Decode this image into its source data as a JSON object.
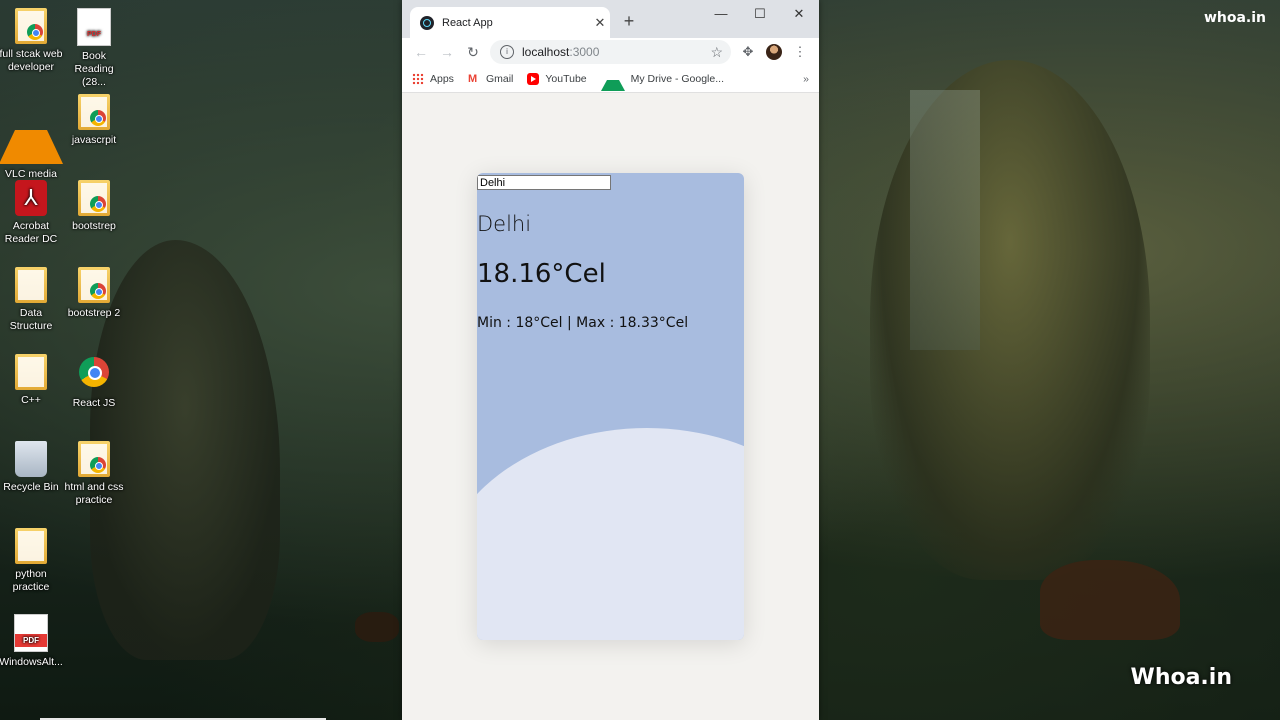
{
  "desktop": {
    "icons": [
      {
        "label": "full stcak web developer",
        "icon": "folder-chrome-icon"
      },
      {
        "label": "Book Reading (28...",
        "icon": "pdf-icon"
      },
      {
        "label": "VLC media player",
        "icon": "vlc-icon"
      },
      {
        "label": "javascrpit",
        "icon": "folder-chrome-icon"
      },
      {
        "label": "Acrobat Reader DC",
        "icon": "acrobat-icon"
      },
      {
        "label": "bootstrep",
        "icon": "folder-chrome-icon"
      },
      {
        "label": "Data Structure",
        "icon": "folder-icon"
      },
      {
        "label": "bootstrep 2",
        "icon": "folder-chrome-icon"
      },
      {
        "label": "C++",
        "icon": "folder-icon"
      },
      {
        "label": "React JS",
        "icon": "chrome-icon"
      },
      {
        "label": "Recycle Bin",
        "icon": "recycle-bin-icon"
      },
      {
        "label": "html and css practice",
        "icon": "folder-chrome-icon"
      },
      {
        "label": "python practice",
        "icon": "folder-icon"
      },
      {
        "label": "WindowsAlt...",
        "icon": "pdf-icon"
      }
    ],
    "watermark_top": "whoa.in",
    "watermark_bottom": "Whoa.in"
  },
  "browser": {
    "tab_title": "React App",
    "new_tab": "+",
    "controls": {
      "minimize": "—",
      "maximize": "☐",
      "close": "✕"
    },
    "url_host": "localhost",
    "url_port": ":3000",
    "bookmarks": [
      {
        "label": "Apps",
        "icon": "apps-grid-icon"
      },
      {
        "label": "Gmail",
        "icon": "gmail-icon"
      },
      {
        "label": "YouTube",
        "icon": "youtube-icon"
      },
      {
        "label": "My Drive - Google...",
        "icon": "google-drive-icon"
      }
    ],
    "bookmarks_overflow": "»"
  },
  "weather": {
    "input_value": "Delhi",
    "city": "Delhi",
    "temperature": "18.16°Cel",
    "minmax": "Min : 18°Cel | Max : 18.33°Cel",
    "colors": {
      "card_top": "#a8bcdf",
      "card_wave": "#e1e6f3",
      "page_bg": "#f3f2ef"
    }
  }
}
